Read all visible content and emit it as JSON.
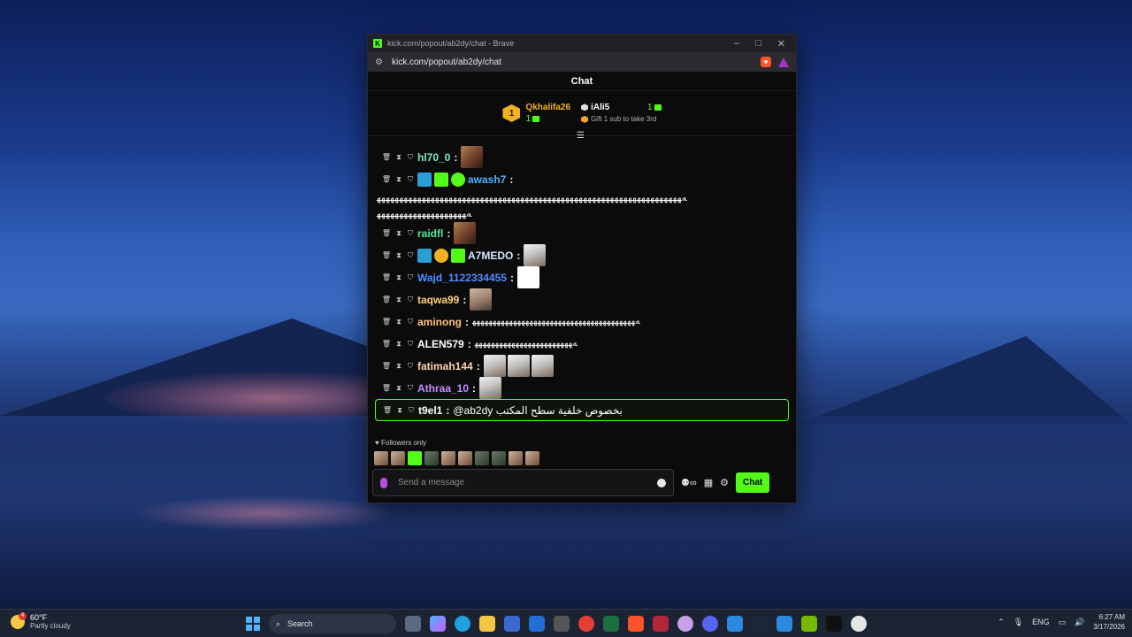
{
  "browser": {
    "title": "kick.com/popout/ab2dy/chat - Brave",
    "url": "kick.com/popout/ab2dy/chat"
  },
  "chat": {
    "header": "Chat",
    "leaderboard": {
      "top_rank": "1",
      "top_user": "Qkhalifa26",
      "top_count": "1",
      "second_user": "iAli5",
      "second_count": "1",
      "hint": "Gift 1 sub to take 3rd"
    },
    "messages": [
      {
        "user": "hl70_0",
        "color": "#7df2c8",
        "text": ""
      },
      {
        "user": "awash7",
        "color": "#4fb3ff",
        "text": ""
      },
      {
        "user": "raidfl",
        "color": "#53e89a",
        "text": ""
      },
      {
        "user": "A7MEDO",
        "color": "#d8e8ff",
        "text": ""
      },
      {
        "user": "Wajd_1122334455",
        "color": "#4f8cff",
        "text": ""
      },
      {
        "user": "taqwa99",
        "color": "#ffd27a",
        "text": ""
      },
      {
        "user": "aminong",
        "color": "#ffc27a",
        "text": "ﻪﻬﻬﻬﻬﻬﻬﻬﻬﻬﻬﻬﻬﻬﻬﻬﻬﻬﻬﻬﻬﻬﻬﻬﻬﻬﻬﻬﻬﻬﻬﻬﻬﻬﻬﻬﻬﻬﻬﻬﻬ"
      },
      {
        "user": "ALEN579",
        "color": "#ffffff",
        "text": "ﻪﻬﻬﻬﻬﻬﻬﻬﻬﻬﻬﻬﻬﻬﻬﻬﻬﻬﻬﻬﻬﻬﻬﻬﻬ"
      },
      {
        "user": "fatimah144",
        "color": "#ffd5b0",
        "text": ""
      },
      {
        "user": "Athraa_10",
        "color": "#c88cff",
        "text": ""
      },
      {
        "user": "t9el1",
        "color": "#ffffff",
        "text": "@ab2dy بخصوص خلفية سطح المكتب"
      }
    ],
    "awash_line1": "ﻪﻬﻬﻬﻬﻬﻬﻬﻬﻬﻬﻬﻬﻬﻬﻬﻬﻬﻬﻬﻬﻬﻬﻬﻬﻬﻬﻬﻬﻬﻬﻬﻬﻬﻬﻬﻬﻬﻬﻬﻬﻬﻬﻬﻬﻬﻬﻬﻬﻬﻬﻬﻬﻬﻬﻬﻬﻬﻬﻬﻬﻬﻬﻬﻬﻬﻬﻬﻬ",
    "awash_line2": "ﻪﻬﻬﻬﻬﻬﻬﻬﻬﻬﻬﻬﻬﻬﻬﻬﻬﻬﻬﻬﻬ",
    "followers_only": "Followers only",
    "input_placeholder": "Send a message",
    "send_label": "Chat"
  },
  "taskbar": {
    "temperature": "60°F",
    "weather": "Partly cloudy",
    "weather_badge": "4",
    "search_label": "Search",
    "language": "ENG",
    "time": "6:27 AM",
    "date": "3/17/2026"
  }
}
